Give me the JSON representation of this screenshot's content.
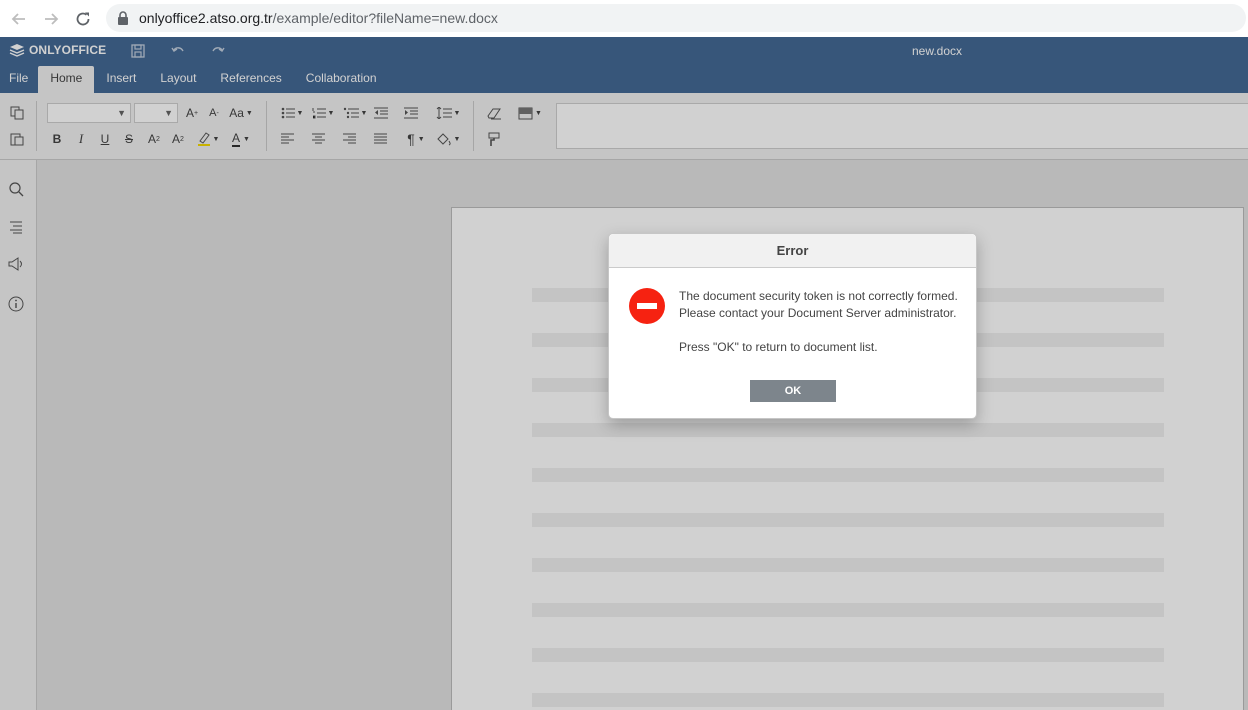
{
  "browser": {
    "url_domain": "onlyoffice2.atso.org.tr",
    "url_path": "/example/editor?fileName=new.docx",
    "icons": [
      "back-icon",
      "forward-icon",
      "reload-icon",
      "lock-icon"
    ]
  },
  "app": {
    "logo_text": "ONLYOFFICE",
    "doc_title": "new.docx",
    "header_icons": [
      "save-icon",
      "undo-icon",
      "redo-icon"
    ]
  },
  "tabs": [
    {
      "label": "File"
    },
    {
      "label": "Home"
    },
    {
      "label": "Insert"
    },
    {
      "label": "Layout"
    },
    {
      "label": "References"
    },
    {
      "label": "Collaboration"
    }
  ],
  "toolbar": {
    "bold": "B",
    "italic": "I",
    "underline": "U",
    "strike": "S",
    "superscript": "A",
    "subscript": "A",
    "grow_font": "A",
    "shrink_font": "A",
    "change_case": "Aa",
    "font_color": "A",
    "nonprint": "¶"
  },
  "colors": {
    "header_bg": "#446995",
    "error_red": "#f62211",
    "ok_button": "#7d858c"
  },
  "dialog": {
    "title": "Error",
    "line1": "The document security token is not correctly formed.",
    "line2": "Please contact your Document Server administrator.",
    "line3": "Press \"OK\" to return to document list.",
    "ok_label": "OK"
  }
}
